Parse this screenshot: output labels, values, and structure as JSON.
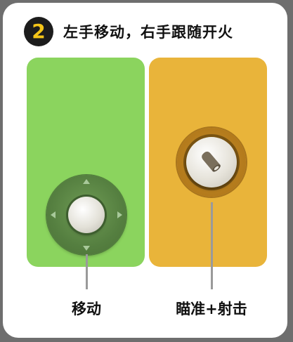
{
  "header": {
    "step_number": "2",
    "title": "左手移动，右手跟随开火"
  },
  "left_panel": {
    "caption": "移动",
    "color": "#8bd45e",
    "control_icon": "joystick-icon"
  },
  "right_panel": {
    "caption": "瞄准+射击",
    "color": "#e9b43a",
    "control_icon": "fire-button-icon"
  },
  "colors": {
    "badge_background": "#1c1c1c",
    "badge_number": "#f5c518",
    "connector": "#9a9a9a"
  }
}
